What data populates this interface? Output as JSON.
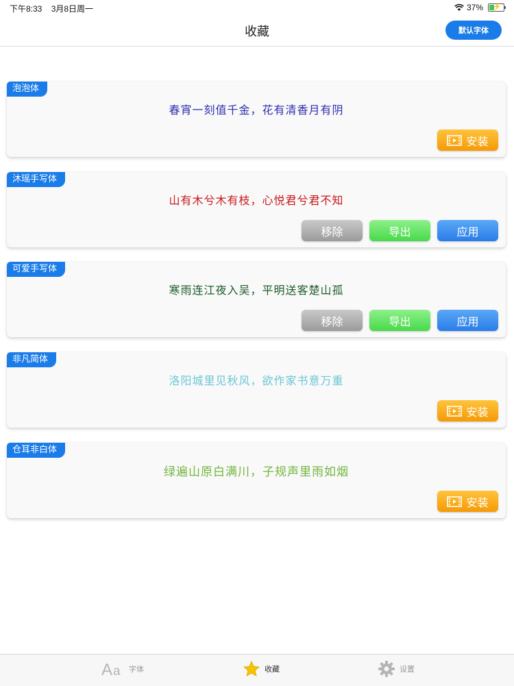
{
  "status": {
    "time": "下午8:33",
    "date": "3月8日周一",
    "battery": "37%",
    "battery_level": 0.37
  },
  "nav": {
    "title": "收藏",
    "default_button": "默认字体"
  },
  "cards": [
    {
      "name": "泡泡体",
      "sample": "春宵一刻值千金，花有清香月有阴",
      "color": "#2f2db0",
      "mode": "install",
      "install_label": "安装"
    },
    {
      "name": "沐瑶手写体",
      "sample": "山有木兮木有枝，心悦君兮君不知",
      "color": "#c81818",
      "mode": "manage",
      "remove_label": "移除",
      "export_label": "导出",
      "apply_label": "应用"
    },
    {
      "name": "可爱手写体",
      "sample": "寒雨连江夜入吴，平明送客楚山孤",
      "color": "#1d5b2a",
      "mode": "manage",
      "remove_label": "移除",
      "export_label": "导出",
      "apply_label": "应用"
    },
    {
      "name": "非凡简体",
      "sample": "洛阳城里见秋风，欲作家书意万重",
      "color": "#6cc7d2",
      "mode": "install",
      "install_label": "安装"
    },
    {
      "name": "仓耳非白体",
      "sample": "绿遍山原白满川，子规声里雨如烟",
      "color": "#72b53a",
      "mode": "install",
      "install_label": "安装"
    }
  ],
  "tabs": [
    {
      "label": "字体",
      "icon": "font-icon"
    },
    {
      "label": "收藏",
      "icon": "star-icon",
      "active": true
    },
    {
      "label": "设置",
      "icon": "gear-icon"
    }
  ],
  "colors": {
    "accent": "#1a7ce8",
    "install": "#f5a10f",
    "export": "#55dd55",
    "remove": "#a8a8a8"
  }
}
